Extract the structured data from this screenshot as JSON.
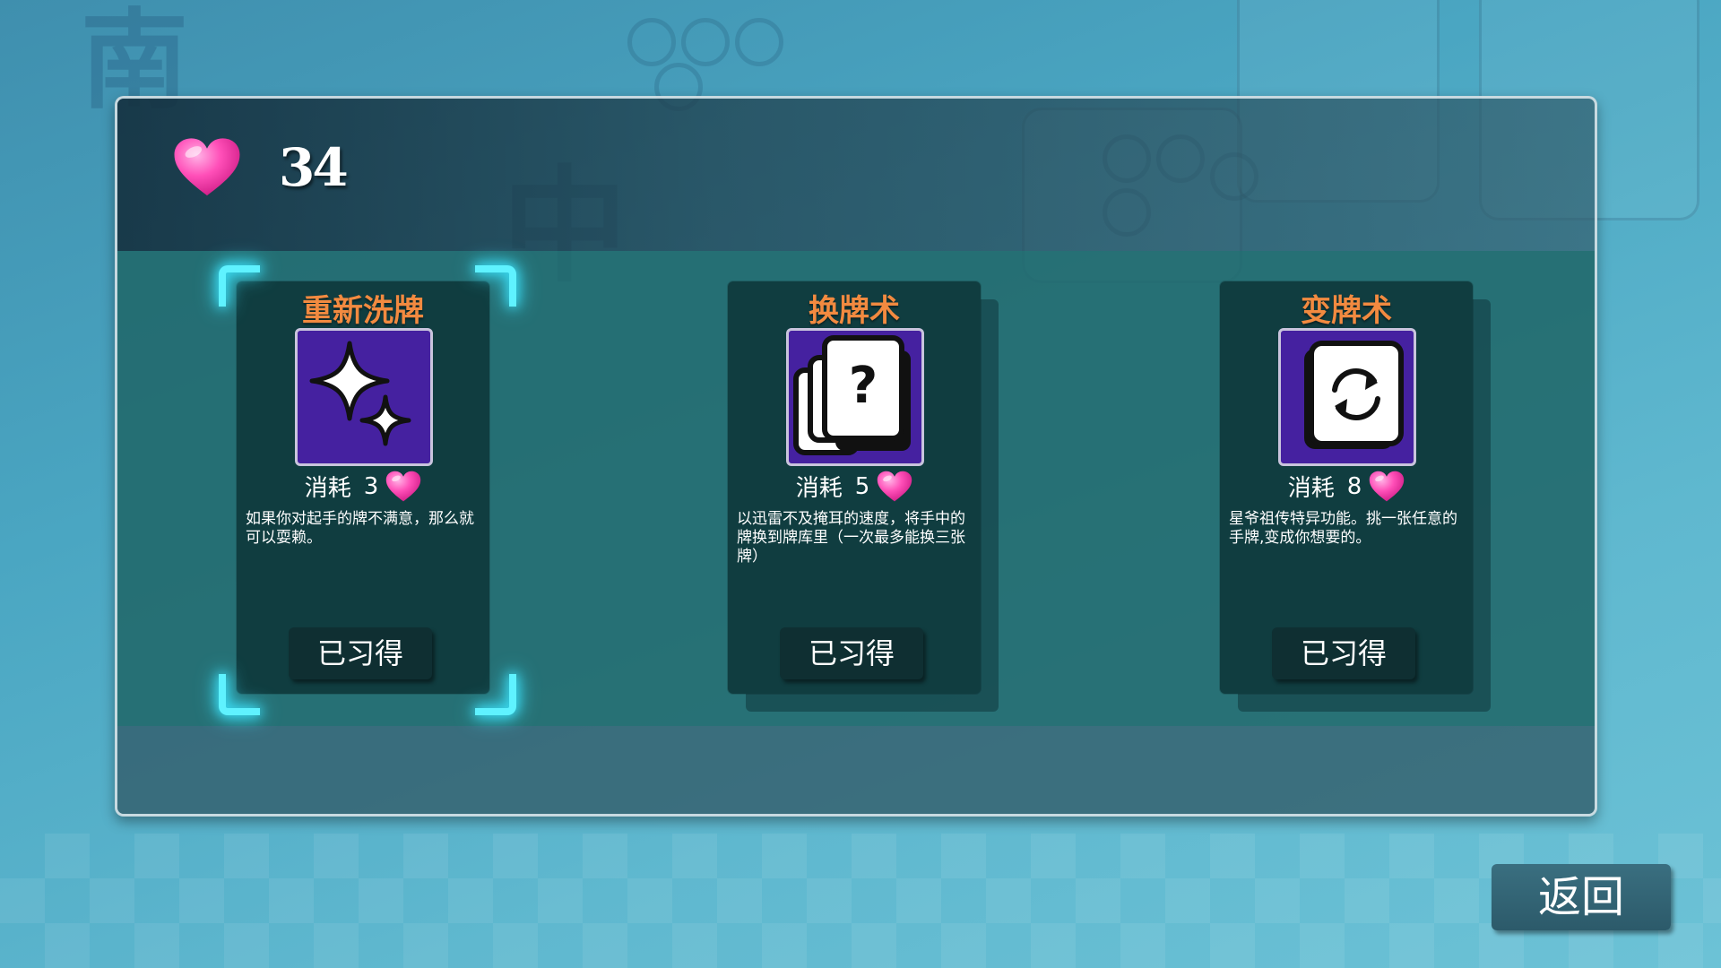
{
  "header": {
    "hearts": "34",
    "heart_icon": "heart-icon",
    "heart_color": "#ff4fb8"
  },
  "skills": [
    {
      "title": "重新洗牌",
      "icon": "sparkles-icon",
      "cost_label": "消耗",
      "cost": "3",
      "description": "如果你对起手的牌不满意，那么就可以耍赖。",
      "button": "已习得",
      "selected": true
    },
    {
      "title": "换牌术",
      "icon": "question-cards-icon",
      "cost_label": "消耗",
      "cost": "5",
      "description": "以迅雷不及掩耳的速度，将手中的牌换到牌库里（一次最多能换三张牌）",
      "button": "已习得",
      "selected": false
    },
    {
      "title": "变牌术",
      "icon": "refresh-card-icon",
      "cost_label": "消耗",
      "cost": "8",
      "description": "星爷祖传特异功能。挑一张任意的手牌,变成你想要的。",
      "button": "已习得",
      "selected": false
    }
  ],
  "footer": {
    "back_label": "返回"
  },
  "colors": {
    "title_orange": "#f28a40",
    "icon_purple": "#4521a0",
    "selection_cyan": "#5ff2ff"
  }
}
